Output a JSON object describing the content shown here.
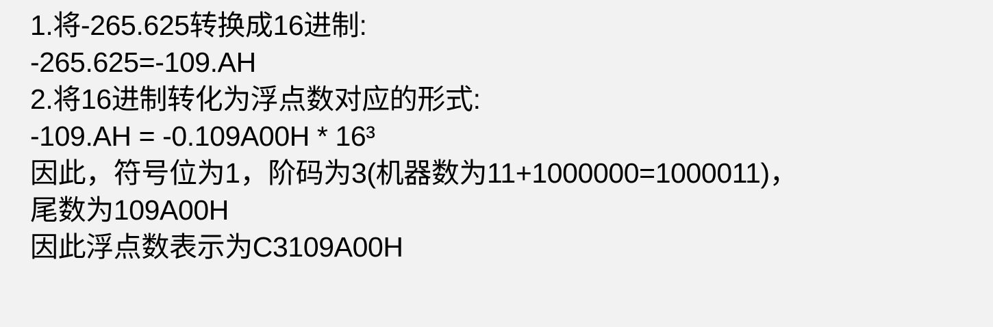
{
  "background_color": "#f2f2f2",
  "text_color": "#000000",
  "lines": [
    "1.将-265.625转换成16进制:",
    "-265.625=-109.AH",
    "2.将16进制转化为浮点数对应的形式:",
    "-109.AH = -0.109A00H * 16³",
    "因此，符号位为1，阶码为3(机器数为11+1000000=1000011)，",
    "尾数为109A00H",
    "因此浮点数表示为C3109A00H"
  ]
}
